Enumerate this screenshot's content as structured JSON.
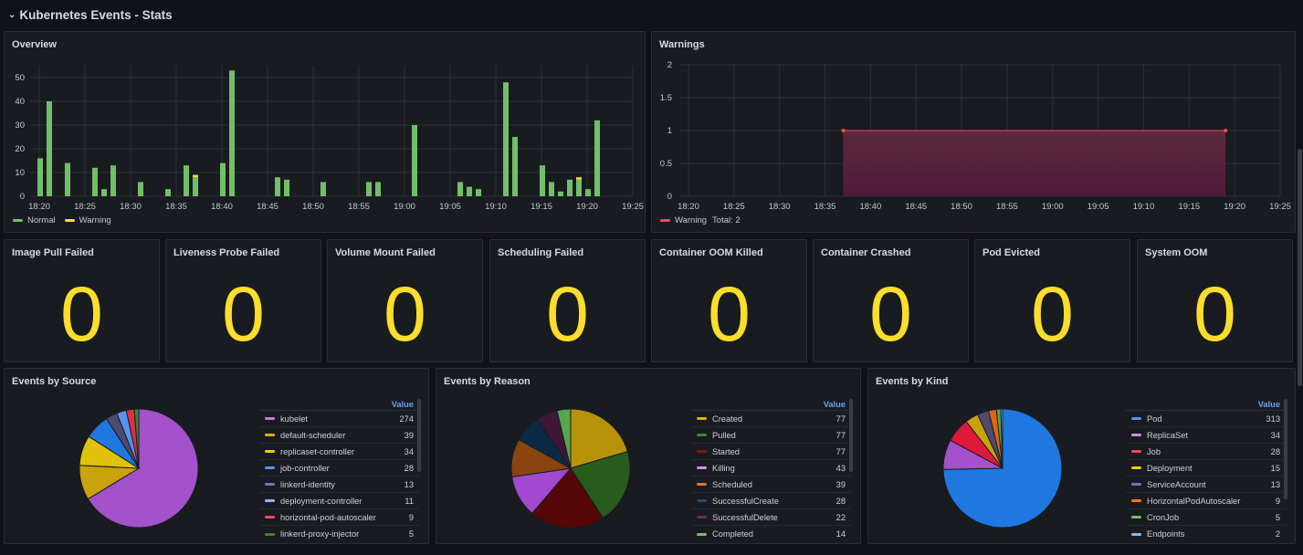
{
  "section": {
    "title": "Kubernetes Events - Stats",
    "chevron_icon": "chevron-down-icon"
  },
  "overview": {
    "title": "Overview",
    "legend": [
      {
        "name": "Normal",
        "color": "#73bf69"
      },
      {
        "name": "Warning",
        "color": "#fade2a"
      }
    ],
    "chart_data": {
      "type": "bar",
      "stacked": true,
      "title": "Overview",
      "xlabel": "",
      "ylabel": "",
      "x_ticks": [
        "18:20",
        "18:25",
        "18:30",
        "18:35",
        "18:40",
        "18:45",
        "18:50",
        "18:55",
        "19:00",
        "19:05",
        "19:10",
        "19:15",
        "19:20",
        "19:25"
      ],
      "y_ticks": [
        0,
        10,
        20,
        30,
        40,
        50
      ],
      "ylim": [
        0,
        55
      ],
      "x_range_minutes": [
        "18:19",
        "19:25"
      ],
      "x": [
        "18:20",
        "18:21",
        "18:23",
        "18:26",
        "18:27",
        "18:28",
        "18:31",
        "18:34",
        "18:36",
        "18:37",
        "18:40",
        "18:41",
        "18:46",
        "18:47",
        "18:51",
        "18:56",
        "18:57",
        "19:01",
        "19:06",
        "19:07",
        "19:08",
        "19:11",
        "19:12",
        "19:15",
        "19:16",
        "19:17",
        "19:18",
        "19:19",
        "19:20",
        "19:21"
      ],
      "series": [
        {
          "name": "Normal",
          "color": "#73bf69",
          "values": [
            16,
            40,
            14,
            12,
            3,
            13,
            6,
            3,
            13,
            8,
            14,
            53,
            8,
            7,
            6,
            6,
            6,
            30,
            6,
            4,
            3,
            48,
            25,
            13,
            6,
            2,
            7,
            7,
            3,
            32
          ]
        },
        {
          "name": "Warning",
          "color": "#fade2a",
          "values": [
            0,
            0,
            0,
            0,
            0,
            0,
            0,
            0,
            0,
            1,
            0,
            0,
            0,
            0,
            0,
            0,
            0,
            0,
            0,
            0,
            0,
            0,
            0,
            0,
            0,
            0,
            0,
            1,
            0,
            0
          ]
        }
      ],
      "legend_position": "bottom-left",
      "grid": true
    }
  },
  "warnings": {
    "title": "Warnings",
    "legend": {
      "name": "Warning",
      "total_label": "Total: 2",
      "color": "#f2495c"
    },
    "chart_data": {
      "type": "area",
      "title": "Warnings",
      "xlabel": "",
      "ylabel": "",
      "x_ticks": [
        "18:20",
        "18:25",
        "18:30",
        "18:35",
        "18:40",
        "18:45",
        "18:50",
        "18:55",
        "19:00",
        "19:05",
        "19:10",
        "19:15",
        "19:20",
        "19:25"
      ],
      "y_ticks": [
        "0",
        "0.5",
        "1",
        "1.5",
        "2"
      ],
      "ylim": [
        0,
        2
      ],
      "x_range_minutes": [
        "18:19",
        "19:25"
      ],
      "series": [
        {
          "name": "Warning",
          "color": "#f2495c",
          "x": [
            "18:37",
            "19:19"
          ],
          "values": [
            1,
            1
          ]
        }
      ],
      "legend_position": "bottom-left",
      "grid": true
    }
  },
  "stats": [
    {
      "title": "Image Pull Failed",
      "value": "0"
    },
    {
      "title": "Liveness Probe Failed",
      "value": "0"
    },
    {
      "title": "Volume Mount Failed",
      "value": "0"
    },
    {
      "title": "Scheduling Failed",
      "value": "0"
    },
    {
      "title": "Container OOM Killed",
      "value": "0"
    },
    {
      "title": "Container Crashed",
      "value": "0"
    },
    {
      "title": "Pod Evicted",
      "value": "0"
    },
    {
      "title": "System OOM",
      "value": "0"
    }
  ],
  "stat_color": "#fade2a",
  "pies": [
    {
      "title": "Events by Source",
      "value_header": "Value",
      "chart_data": {
        "type": "pie",
        "title": "Events by Source",
        "legend_position": "right",
        "slices": [
          {
            "label": "kubelet",
            "value": 274,
            "color": "#a352cc"
          },
          {
            "label": "default-scheduler",
            "value": 39,
            "color": "#c9a20c"
          },
          {
            "label": "replicaset-controller",
            "value": 34,
            "color": "#e0c20a"
          },
          {
            "label": "job-controller",
            "value": 28,
            "color": "#1f78e0"
          },
          {
            "label": "linkerd-identity",
            "value": 13,
            "color": "#4e4a72"
          },
          {
            "label": "deployment-controller",
            "value": 11,
            "color": "#5794f2"
          },
          {
            "label": "horizontal-pod-autoscaler",
            "value": 9,
            "color": "#e02f44"
          },
          {
            "label": "linkerd-proxy-injector",
            "value": 5,
            "color": "#37872d"
          }
        ]
      }
    },
    {
      "title": "Events by Reason",
      "value_header": "Value",
      "chart_data": {
        "type": "pie",
        "title": "Events by Reason",
        "legend_position": "right",
        "slices": [
          {
            "label": "Created",
            "value": 77,
            "color": "#b8930a"
          },
          {
            "label": "Pulled",
            "value": 77,
            "color": "#275c1c"
          },
          {
            "label": "Started",
            "value": 77,
            "color": "#560606"
          },
          {
            "label": "Killing",
            "value": 43,
            "color": "#a348d0"
          },
          {
            "label": "Scheduled",
            "value": 39,
            "color": "#8a4410"
          },
          {
            "label": "SuccessfulCreate",
            "value": 28,
            "color": "#0b2944"
          },
          {
            "label": "SuccessfulDelete",
            "value": 22,
            "color": "#3d1638"
          },
          {
            "label": "Completed",
            "value": 14,
            "color": "#56a64b"
          }
        ]
      }
    },
    {
      "title": "Events by Kind",
      "value_header": "Value",
      "chart_data": {
        "type": "pie",
        "title": "Events by Kind",
        "legend_position": "right",
        "slices": [
          {
            "label": "Pod",
            "value": 313,
            "color": "#1f78e0"
          },
          {
            "label": "ReplicaSet",
            "value": 34,
            "color": "#a352cc"
          },
          {
            "label": "Job",
            "value": 28,
            "color": "#e0183a"
          },
          {
            "label": "Deployment",
            "value": 15,
            "color": "#c9a20c"
          },
          {
            "label": "ServiceAccount",
            "value": 13,
            "color": "#4e4a72"
          },
          {
            "label": "HorizontalPodAutoscaler",
            "value": 9,
            "color": "#e0640a"
          },
          {
            "label": "CronJob",
            "value": 5,
            "color": "#56a64b"
          },
          {
            "label": "Endpoints",
            "value": 2,
            "color": "#8ab8ff"
          }
        ]
      }
    }
  ],
  "legend_colors": {
    "Events by Source": [
      "#c77ce0",
      "#e0b400",
      "#f2cc0c",
      "#5794f2",
      "#806eb7",
      "#8ab8ff",
      "#f2495c",
      "#37872d"
    ],
    "Events by Reason": [
      "#e0b400",
      "#37872d",
      "#8f1010",
      "#ca95e5",
      "#e0752d",
      "#1f4e79",
      "#6f2a66",
      "#73bf69"
    ],
    "Events by Kind": [
      "#5794f2",
      "#ca95e5",
      "#f2495c",
      "#f2cc0c",
      "#806eb7",
      "#ff780a",
      "#73bf69",
      "#8ab8ff"
    ]
  }
}
